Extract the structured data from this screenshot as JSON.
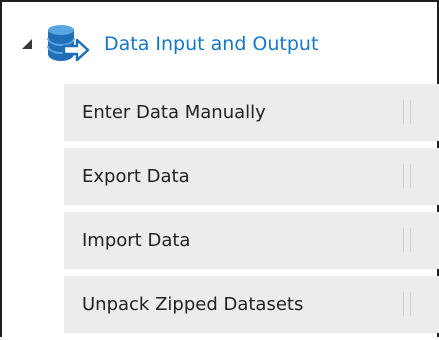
{
  "group": {
    "title": "Data Input and Output",
    "expanded": true,
    "expand_icon": "collapse-triangle",
    "icon": "database-export-icon",
    "title_color": "#1677c9"
  },
  "modules": [
    {
      "label": "Enter Data Manually"
    },
    {
      "label": "Export Data"
    },
    {
      "label": "Import Data"
    },
    {
      "label": "Unpack Zipped Datasets"
    }
  ]
}
